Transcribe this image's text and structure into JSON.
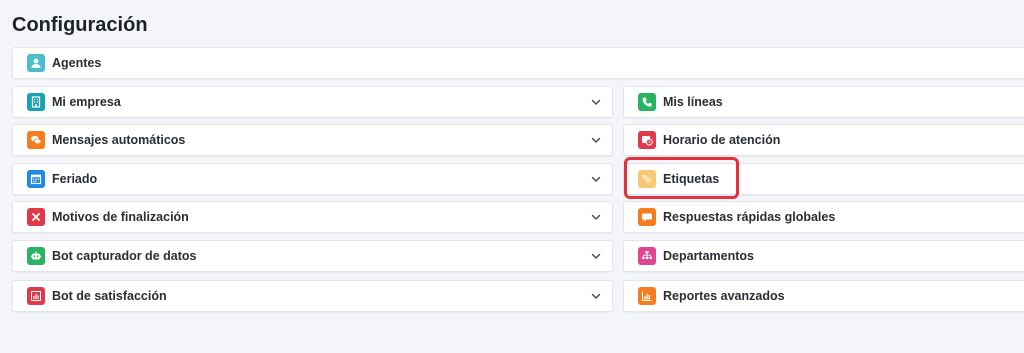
{
  "page": {
    "title": "Configuración"
  },
  "colors": {
    "teal": "#4bbfc9",
    "cyan": "#19a0b9",
    "orange": "#f57c1f",
    "blue": "#1e88e5",
    "red": "#e0394b",
    "green": "#28b463",
    "light_orange": "#f7c976",
    "pink": "#e0458f",
    "highlight": "#e5313d"
  },
  "full_item": {
    "label": "Agentes",
    "icon": "user-icon"
  },
  "left_items": [
    {
      "label": "Mi empresa",
      "icon": "building-icon"
    },
    {
      "label": "Mensajes automáticos",
      "icon": "chat-icon"
    },
    {
      "label": "Feriado",
      "icon": "calendar-icon"
    },
    {
      "label": "Motivos de finalización",
      "icon": "close-icon"
    },
    {
      "label": "Bot capturador de datos",
      "icon": "robot-icon"
    },
    {
      "label": "Bot de satisfacción",
      "icon": "bar-chart-icon"
    }
  ],
  "right_items": [
    {
      "label": "Mis líneas",
      "icon": "phone-icon"
    },
    {
      "label": "Horario de atención",
      "icon": "clock-icon"
    },
    {
      "label": "Etiquetas",
      "icon": "tags-icon"
    },
    {
      "label": "Respuestas rápidas globales",
      "icon": "speech-bubble-icon"
    },
    {
      "label": "Departamentos",
      "icon": "sitemap-icon"
    },
    {
      "label": "Reportes avanzados",
      "icon": "chart-icon"
    }
  ]
}
